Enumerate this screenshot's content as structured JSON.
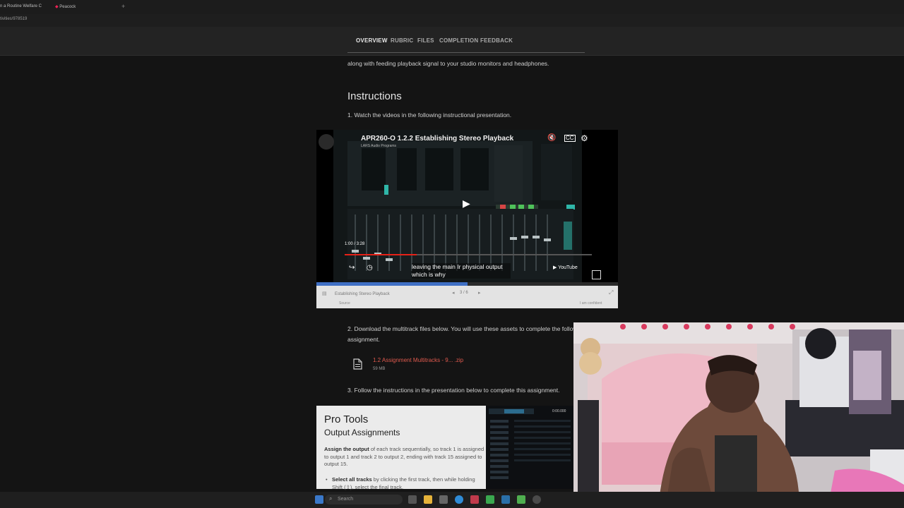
{
  "browser": {
    "tabs": [
      {
        "label": "n a Routine Welfare C"
      },
      {
        "label": "Peacock"
      }
    ],
    "new_tab_glyph": "+",
    "url": "tivities/978519"
  },
  "course_nav": {
    "items": [
      "OVERVIEW",
      "RUBRIC",
      "FILES",
      "COMPLETION",
      "FEEDBACK"
    ],
    "active": "OVERVIEW"
  },
  "content": {
    "intro_line": "along with feeding playback signal to your studio monitors and headphones.",
    "heading": "Instructions",
    "step1": "1. Watch the videos in the following instructional presentation.",
    "step2_line1": "2. Download the multitrack files below. You will use these assets to complete the following",
    "step2_line2": "assignment.",
    "step3": "3. Follow the instructions in the presentation below to complete this assignment."
  },
  "video": {
    "title": "APR260-O 1.2.2 Establishing Stereo Playback",
    "subtitle": "LARS Audio Programs",
    "time": "1:00 / 3:28",
    "caption_line1": "leaving the main Ir physical output",
    "caption_line2": "which is why",
    "youtube_label": "YouTube",
    "progress_fraction": 0.29,
    "presentation_progress_fraction": 0.5,
    "footer_label": "Establishing Stereo Playback",
    "pager": "3 / 6",
    "footer_small_left": "Source",
    "footer_small_right": "I am confident"
  },
  "attachment": {
    "name": "1.2 Assignment Multitracks - 9... .zip",
    "size": "59 MB",
    "icon": "file-icon"
  },
  "slide": {
    "title": "Pro Tools",
    "subtitle": "Output Assignments",
    "para_bold": "Assign the output",
    "para_rest": " of each track sequentially, so track 1 is assigned to output 1 and track 2 to output 2, ending with track 15 assigned to output 15.",
    "bullet_bold": "Select all tracks",
    "bullet_rest": " by clicking the first track, then while holding Shift (⇧), select the final track.",
    "screenshot_time": "0:00.000"
  },
  "taskbar": {
    "search_label": "Search"
  },
  "colors": {
    "accent_link": "#e05a4e",
    "progress_red": "#e62117",
    "presentation_blue": "#3f6fc4"
  }
}
